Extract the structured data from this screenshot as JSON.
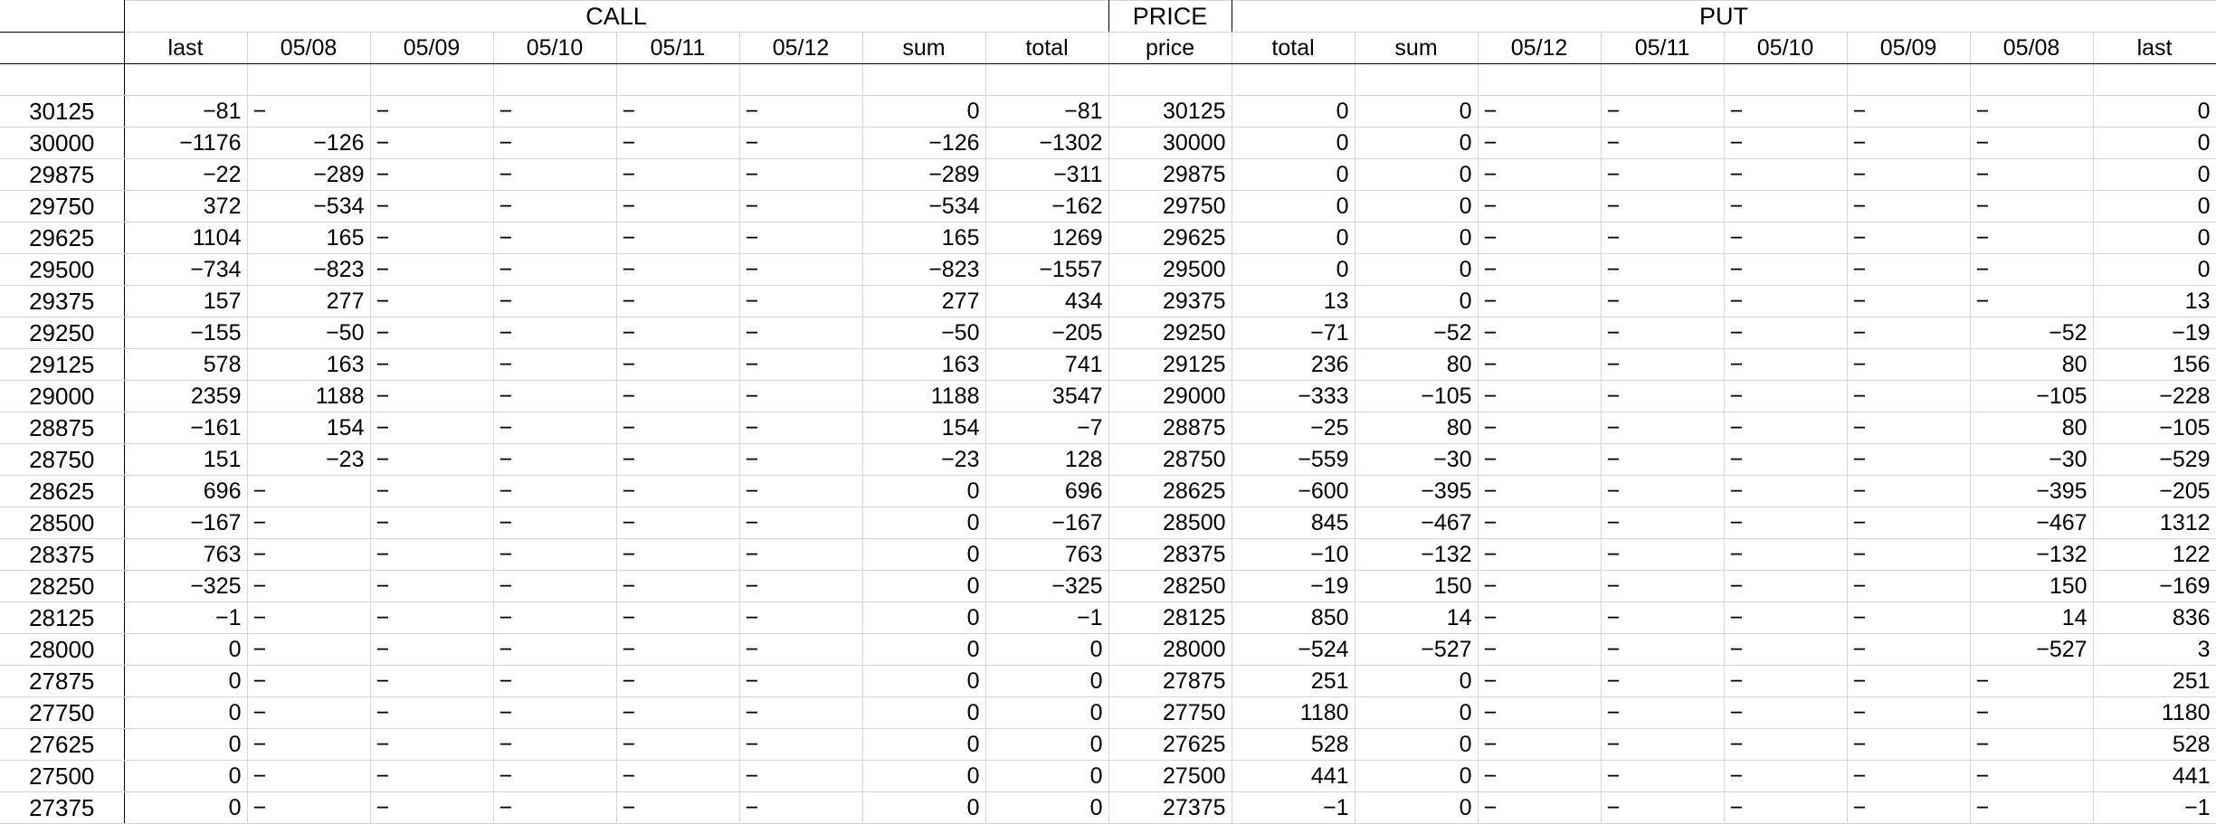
{
  "groups": {
    "call": "CALL",
    "price": "PRICE",
    "put": "PUT"
  },
  "call_headers": [
    "last",
    "05/08",
    "05/09",
    "05/10",
    "05/11",
    "05/12",
    "sum",
    "total"
  ],
  "price_header": "price",
  "put_headers": [
    "total",
    "sum",
    "05/12",
    "05/11",
    "05/10",
    "05/09",
    "05/08",
    "last"
  ],
  "rows": [
    {
      "strike": "30125",
      "call": [
        "−81",
        "−",
        "−",
        "−",
        "−",
        "−",
        "0",
        "−81"
      ],
      "price": "30125",
      "put": [
        "0",
        "0",
        "−",
        "−",
        "−",
        "−",
        "−",
        "0"
      ]
    },
    {
      "strike": "30000",
      "call": [
        "−1176",
        "−126",
        "−",
        "−",
        "−",
        "−",
        "−126",
        "−1302"
      ],
      "price": "30000",
      "put": [
        "0",
        "0",
        "−",
        "−",
        "−",
        "−",
        "−",
        "0"
      ]
    },
    {
      "strike": "29875",
      "call": [
        "−22",
        "−289",
        "−",
        "−",
        "−",
        "−",
        "−289",
        "−311"
      ],
      "price": "29875",
      "put": [
        "0",
        "0",
        "−",
        "−",
        "−",
        "−",
        "−",
        "0"
      ]
    },
    {
      "strike": "29750",
      "call": [
        "372",
        "−534",
        "−",
        "−",
        "−",
        "−",
        "−534",
        "−162"
      ],
      "price": "29750",
      "put": [
        "0",
        "0",
        "−",
        "−",
        "−",
        "−",
        "−",
        "0"
      ]
    },
    {
      "strike": "29625",
      "call": [
        "1104",
        "165",
        "−",
        "−",
        "−",
        "−",
        "165",
        "1269"
      ],
      "price": "29625",
      "put": [
        "0",
        "0",
        "−",
        "−",
        "−",
        "−",
        "−",
        "0"
      ]
    },
    {
      "strike": "29500",
      "call": [
        "−734",
        "−823",
        "−",
        "−",
        "−",
        "−",
        "−823",
        "−1557"
      ],
      "price": "29500",
      "put": [
        "0",
        "0",
        "−",
        "−",
        "−",
        "−",
        "−",
        "0"
      ]
    },
    {
      "strike": "29375",
      "call": [
        "157",
        "277",
        "−",
        "−",
        "−",
        "−",
        "277",
        "434"
      ],
      "price": "29375",
      "put": [
        "13",
        "0",
        "−",
        "−",
        "−",
        "−",
        "−",
        "13"
      ]
    },
    {
      "strike": "29250",
      "call": [
        "−155",
        "−50",
        "−",
        "−",
        "−",
        "−",
        "−50",
        "−205"
      ],
      "price": "29250",
      "put": [
        "−71",
        "−52",
        "−",
        "−",
        "−",
        "−",
        "−52",
        "−19"
      ]
    },
    {
      "strike": "29125",
      "call": [
        "578",
        "163",
        "−",
        "−",
        "−",
        "−",
        "163",
        "741"
      ],
      "price": "29125",
      "put": [
        "236",
        "80",
        "−",
        "−",
        "−",
        "−",
        "80",
        "156"
      ]
    },
    {
      "strike": "29000",
      "call": [
        "2359",
        "1188",
        "−",
        "−",
        "−",
        "−",
        "1188",
        "3547"
      ],
      "price": "29000",
      "put": [
        "−333",
        "−105",
        "−",
        "−",
        "−",
        "−",
        "−105",
        "−228"
      ]
    },
    {
      "strike": "28875",
      "call": [
        "−161",
        "154",
        "−",
        "−",
        "−",
        "−",
        "154",
        "−7"
      ],
      "price": "28875",
      "put": [
        "−25",
        "80",
        "−",
        "−",
        "−",
        "−",
        "80",
        "−105"
      ]
    },
    {
      "strike": "28750",
      "call": [
        "151",
        "−23",
        "−",
        "−",
        "−",
        "−",
        "−23",
        "128"
      ],
      "price": "28750",
      "put": [
        "−559",
        "−30",
        "−",
        "−",
        "−",
        "−",
        "−30",
        "−529"
      ]
    },
    {
      "strike": "28625",
      "call": [
        "696",
        "−",
        "−",
        "−",
        "−",
        "−",
        "0",
        "696"
      ],
      "price": "28625",
      "put": [
        "−600",
        "−395",
        "−",
        "−",
        "−",
        "−",
        "−395",
        "−205"
      ]
    },
    {
      "strike": "28500",
      "call": [
        "−167",
        "−",
        "−",
        "−",
        "−",
        "−",
        "0",
        "−167"
      ],
      "price": "28500",
      "put": [
        "845",
        "−467",
        "−",
        "−",
        "−",
        "−",
        "−467",
        "1312"
      ]
    },
    {
      "strike": "28375",
      "call": [
        "763",
        "−",
        "−",
        "−",
        "−",
        "−",
        "0",
        "763"
      ],
      "price": "28375",
      "put": [
        "−10",
        "−132",
        "−",
        "−",
        "−",
        "−",
        "−132",
        "122"
      ]
    },
    {
      "strike": "28250",
      "call": [
        "−325",
        "−",
        "−",
        "−",
        "−",
        "−",
        "0",
        "−325"
      ],
      "price": "28250",
      "put": [
        "−19",
        "150",
        "−",
        "−",
        "−",
        "−",
        "150",
        "−169"
      ]
    },
    {
      "strike": "28125",
      "call": [
        "−1",
        "−",
        "−",
        "−",
        "−",
        "−",
        "0",
        "−1"
      ],
      "price": "28125",
      "put": [
        "850",
        "14",
        "−",
        "−",
        "−",
        "−",
        "14",
        "836"
      ]
    },
    {
      "strike": "28000",
      "call": [
        "0",
        "−",
        "−",
        "−",
        "−",
        "−",
        "0",
        "0"
      ],
      "price": "28000",
      "put": [
        "−524",
        "−527",
        "−",
        "−",
        "−",
        "−",
        "−527",
        "3"
      ]
    },
    {
      "strike": "27875",
      "call": [
        "0",
        "−",
        "−",
        "−",
        "−",
        "−",
        "0",
        "0"
      ],
      "price": "27875",
      "put": [
        "251",
        "0",
        "−",
        "−",
        "−",
        "−",
        "−",
        "251"
      ]
    },
    {
      "strike": "27750",
      "call": [
        "0",
        "−",
        "−",
        "−",
        "−",
        "−",
        "0",
        "0"
      ],
      "price": "27750",
      "put": [
        "1180",
        "0",
        "−",
        "−",
        "−",
        "−",
        "−",
        "1180"
      ]
    },
    {
      "strike": "27625",
      "call": [
        "0",
        "−",
        "−",
        "−",
        "−",
        "−",
        "0",
        "0"
      ],
      "price": "27625",
      "put": [
        "528",
        "0",
        "−",
        "−",
        "−",
        "−",
        "−",
        "528"
      ]
    },
    {
      "strike": "27500",
      "call": [
        "0",
        "−",
        "−",
        "−",
        "−",
        "−",
        "0",
        "0"
      ],
      "price": "27500",
      "put": [
        "441",
        "0",
        "−",
        "−",
        "−",
        "−",
        "−",
        "441"
      ]
    },
    {
      "strike": "27375",
      "call": [
        "0",
        "−",
        "−",
        "−",
        "−",
        "−",
        "0",
        "0"
      ],
      "price": "27375",
      "put": [
        "−1",
        "0",
        "−",
        "−",
        "−",
        "−",
        "−",
        "−1"
      ]
    }
  ]
}
